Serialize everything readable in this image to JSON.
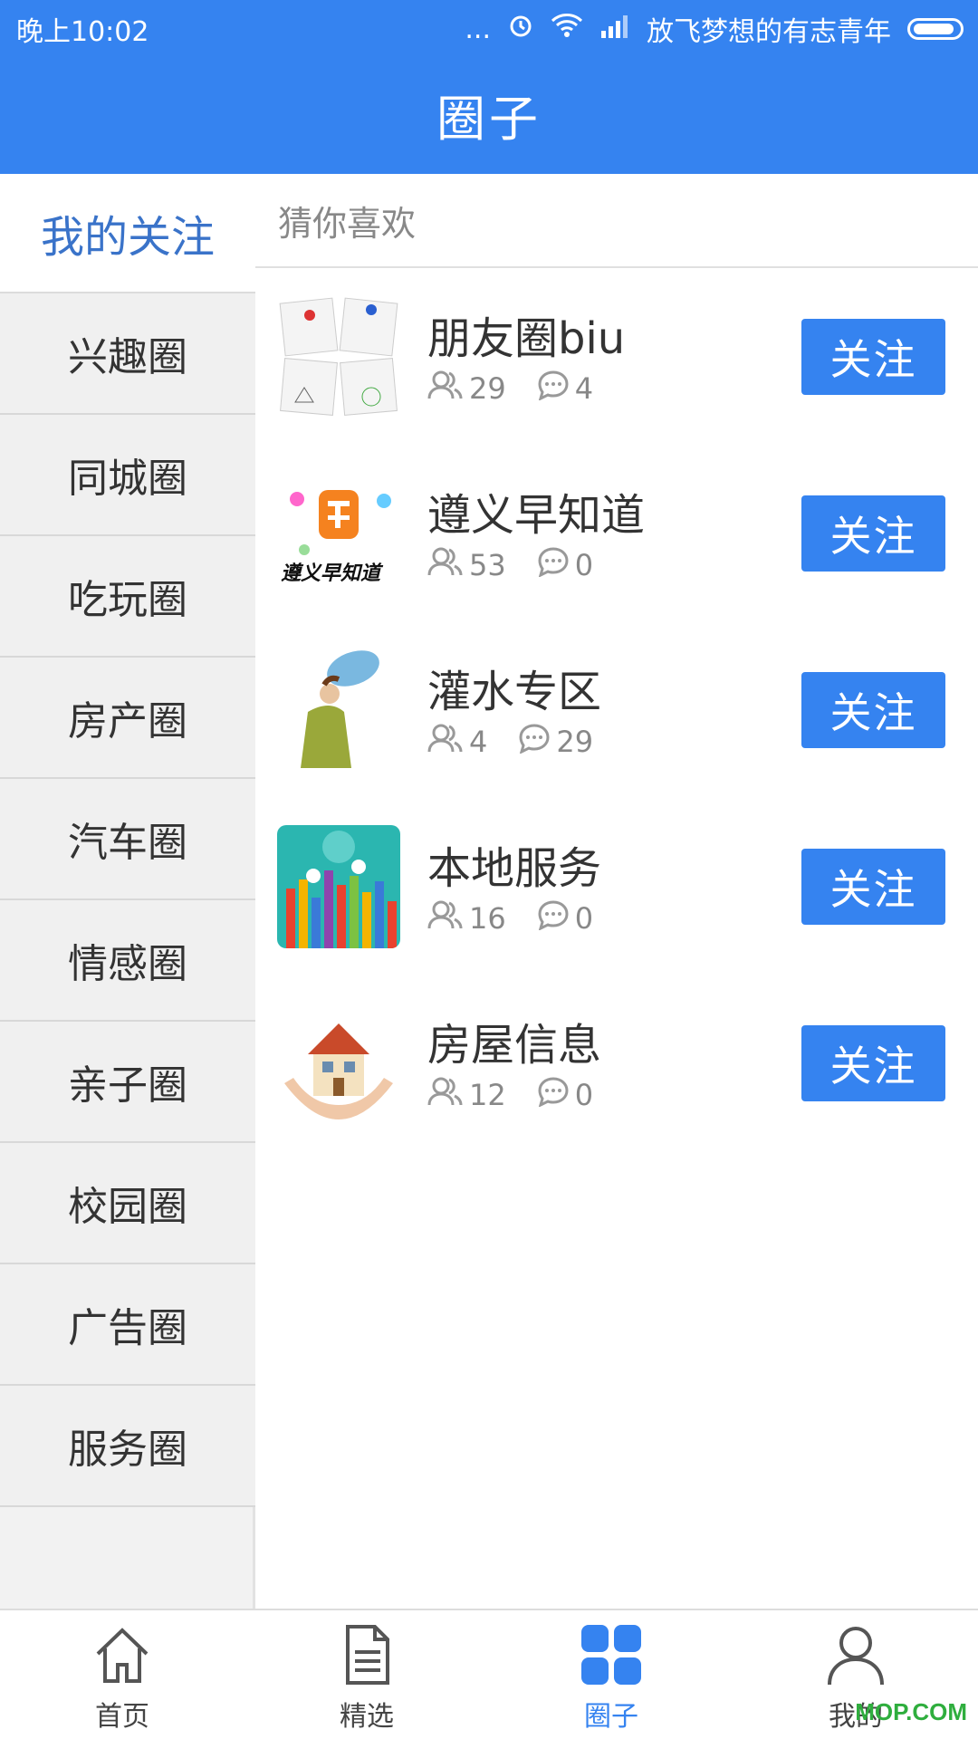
{
  "status_bar": {
    "time": "晚上10:02",
    "dots": "...",
    "carrier": "放飞梦想的有志青年"
  },
  "header": {
    "title": "圈子"
  },
  "sidebar": {
    "my_follow": "我的关注",
    "categories": [
      "兴趣圈",
      "同城圈",
      "吃玩圈",
      "房产圈",
      "汽车圈",
      "情感圈",
      "亲子圈",
      "校园圈",
      "广告圈",
      "服务圈"
    ]
  },
  "main": {
    "section_title": "猜你喜欢",
    "circles": [
      {
        "name": "朋友圈biu",
        "members": "29",
        "posts": "4",
        "button": "关注"
      },
      {
        "name": "遵义早知道",
        "members": "53",
        "posts": "0",
        "button": "关注",
        "logo_text": "遵义早知道"
      },
      {
        "name": "灌水专区",
        "members": "4",
        "posts": "29",
        "button": "关注"
      },
      {
        "name": "本地服务",
        "members": "16",
        "posts": "0",
        "button": "关注"
      },
      {
        "name": "房屋信息",
        "members": "12",
        "posts": "0",
        "button": "关注"
      }
    ]
  },
  "bottom_nav": [
    {
      "label": "首页",
      "icon": "home-icon"
    },
    {
      "label": "精选",
      "icon": "document-icon"
    },
    {
      "label": "圈子",
      "icon": "grid-icon",
      "active": true
    },
    {
      "label": "我的",
      "icon": "user-icon"
    }
  ],
  "watermark": "MOP.COM",
  "colors": {
    "primary": "#3583f0",
    "sidebar_bg": "#f0f0f0",
    "my_follow_text": "#3a73c9"
  }
}
